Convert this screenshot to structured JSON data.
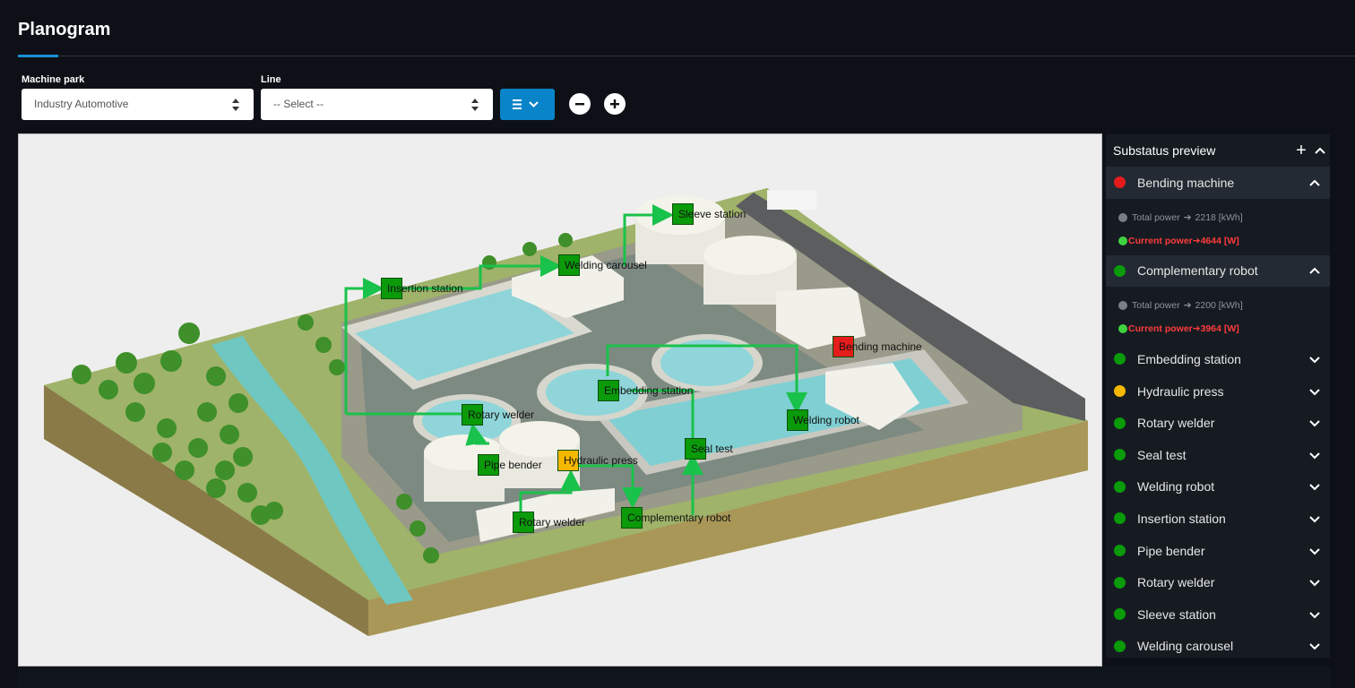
{
  "page": {
    "title": "Planogram"
  },
  "filters": {
    "machine_park": {
      "label": "Machine park",
      "value": "Industry Automotive"
    },
    "line": {
      "label": "Line",
      "value": "-- Select --"
    }
  },
  "toolbar": {
    "menu_icon": "list-icon",
    "zoom_out_icon": "minus-icon",
    "zoom_in_icon": "plus-icon"
  },
  "map": {
    "markers": [
      {
        "label": "Sleeve station",
        "status": "green"
      },
      {
        "label": "Welding carousel",
        "status": "green"
      },
      {
        "label": "Insertion station",
        "status": "green"
      },
      {
        "label": "Bending machine",
        "status": "red"
      },
      {
        "label": "Embedding station",
        "status": "green"
      },
      {
        "label": "Rotary welder",
        "status": "green"
      },
      {
        "label": "Welding robot",
        "status": "green"
      },
      {
        "label": "Seal test",
        "status": "green"
      },
      {
        "label": "Hydraulic press",
        "status": "yellow"
      },
      {
        "label": "Pipe bender",
        "status": "green"
      },
      {
        "label": "Rotary welder",
        "status": "green"
      },
      {
        "label": "Complementary robot",
        "status": "green"
      }
    ]
  },
  "substatus": {
    "title": "Substatus preview",
    "items": [
      {
        "name": "Bending machine",
        "status": "red",
        "expanded": true,
        "total_power": "Total power",
        "total_value": "2218 [kWh]",
        "current_power": "Current power",
        "current_value": "4644 [W]"
      },
      {
        "name": "Complementary robot",
        "status": "green",
        "expanded": true,
        "total_power": "Total power",
        "total_value": "2200 [kWh]",
        "current_power": "Current power",
        "current_value": "3964 [W]"
      },
      {
        "name": "Embedding station",
        "status": "green",
        "expanded": false
      },
      {
        "name": "Hydraulic press",
        "status": "yellow",
        "expanded": false
      },
      {
        "name": "Rotary welder",
        "status": "green",
        "expanded": false
      },
      {
        "name": "Seal test",
        "status": "green",
        "expanded": false
      },
      {
        "name": "Welding robot",
        "status": "green",
        "expanded": false
      },
      {
        "name": "Insertion station",
        "status": "green",
        "expanded": false
      },
      {
        "name": "Pipe bender",
        "status": "green",
        "expanded": false
      },
      {
        "name": "Rotary welder",
        "status": "green",
        "expanded": false
      },
      {
        "name": "Sleeve station",
        "status": "green",
        "expanded": false
      },
      {
        "name": "Welding carousel",
        "status": "green",
        "expanded": false
      }
    ]
  },
  "colors": {
    "green": "#0a9a0a",
    "red": "#e61c1c",
    "yellow": "#f5b800",
    "accent": "#0a84c9",
    "flow": "#19c24a"
  }
}
